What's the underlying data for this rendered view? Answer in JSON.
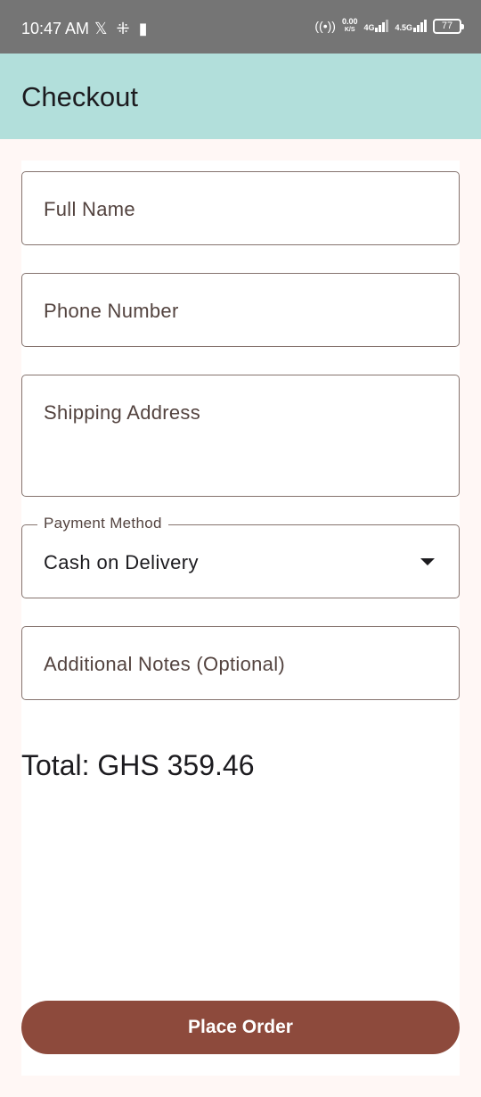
{
  "status_bar": {
    "time": "10:47 AM",
    "network_speed_value": "0.00",
    "network_speed_unit": "K/S",
    "network_1": "4G",
    "network_2": "4.5G",
    "battery": "77",
    "icons": [
      "x-app-icon",
      "app-grid-icon",
      "sd-card-icon",
      "hotspot-icon",
      "signal-icon",
      "battery-icon"
    ]
  },
  "app_bar": {
    "title": "Checkout",
    "background": "#b2dfdb"
  },
  "form": {
    "full_name_placeholder": "Full Name",
    "phone_placeholder": "Phone Number",
    "address_placeholder": "Shipping Address",
    "payment_label": "Payment Method",
    "payment_value": "Cash on Delivery",
    "notes_placeholder": "Additional Notes (Optional)"
  },
  "total_text": "Total: GHS 359.46",
  "place_order_label": "Place Order",
  "colors": {
    "primary": "#8d4a3c",
    "outline": "#85736e",
    "background": "#fff7f5"
  }
}
